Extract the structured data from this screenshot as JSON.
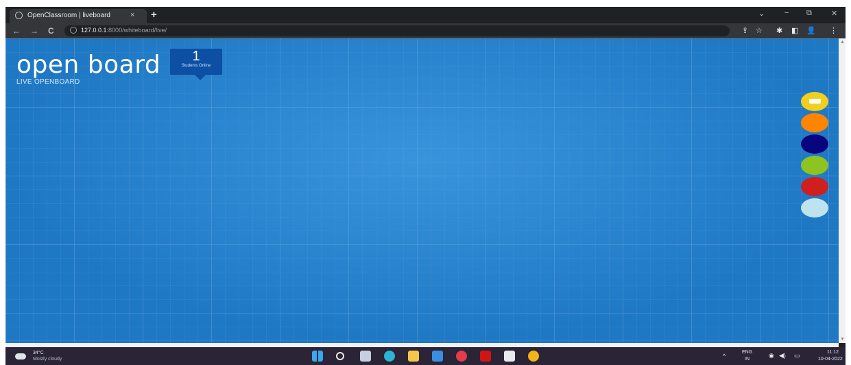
{
  "browser": {
    "tab_title": "OpenClassroom | liveboard",
    "tab_close": "×",
    "new_tab": "+",
    "window_controls": {
      "chevron": "⌄",
      "minimize": "−",
      "restore": "⧉",
      "close": "✕"
    },
    "nav": {
      "back": "←",
      "forward": "→",
      "reload": "C"
    },
    "address": {
      "host": "127.0.0.1",
      "path": ":8000/whiteboard/live/"
    },
    "toolbar_icons": [
      "share-icon",
      "star-icon",
      "extensions-icon",
      "sidebar-icon",
      "profile-icon",
      "menu-icon"
    ],
    "toolbar_glyphs": {
      "share": "⇪",
      "star": "☆",
      "extensions": "✱",
      "sidebar": "◧",
      "profile": "👤",
      "menu": "⋮"
    }
  },
  "board": {
    "brand": "open board",
    "subtitle": "LIVE OPENBOARD",
    "online_count": "1",
    "online_label": "Students Online",
    "palette": [
      {
        "name": "yellow",
        "color": "#f2cf1d",
        "selected": true
      },
      {
        "name": "orange",
        "color": "#ff8400"
      },
      {
        "name": "navy",
        "color": "#08047e"
      },
      {
        "name": "green",
        "color": "#8dc41f"
      },
      {
        "name": "red",
        "color": "#cf1f1f"
      },
      {
        "name": "light-blue",
        "color": "#bde4ee"
      }
    ]
  },
  "taskbar": {
    "weather_temp": "34°C",
    "weather_desc": "Mostly cloudy",
    "apps": [
      {
        "name": "start",
        "color": "#38a7ee"
      },
      {
        "name": "search",
        "color": "#e8eaed"
      },
      {
        "name": "task-view",
        "color": "#c6cfe0"
      },
      {
        "name": "edge",
        "color": "#2cb4d6"
      },
      {
        "name": "file-explorer",
        "color": "#f3c74a"
      },
      {
        "name": "store",
        "color": "#3b8fe0"
      },
      {
        "name": "opera",
        "color": "#e43c4a"
      },
      {
        "name": "netflix",
        "color": "#d11414"
      },
      {
        "name": "terminal",
        "color": "#e8eaed"
      },
      {
        "name": "chrome",
        "color": "#f2b418"
      }
    ],
    "tray_chevron": "^",
    "lang_top": "ENG",
    "lang_bottom": "IN",
    "tray_glyphs": {
      "wifi": "◉",
      "volume": "◀)",
      "battery": "▭"
    },
    "time": "11:12",
    "date": "10-04-2022"
  }
}
